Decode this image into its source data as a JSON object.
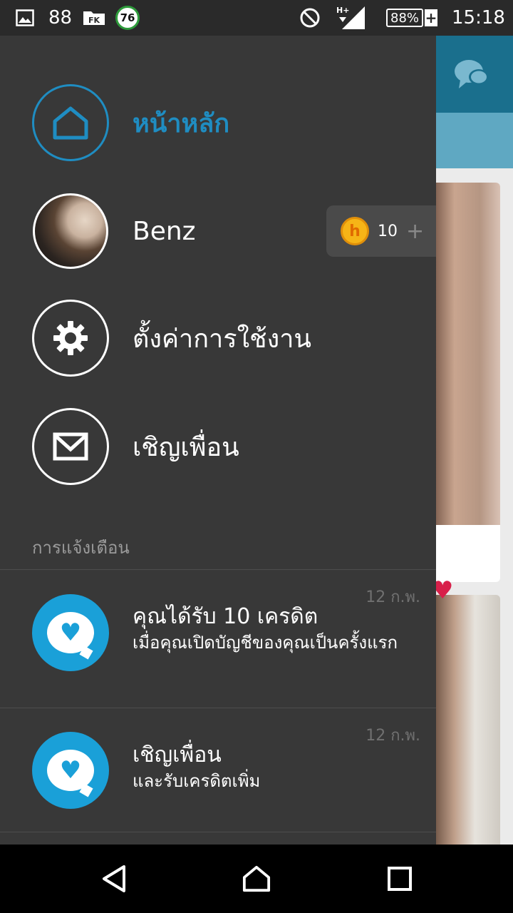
{
  "status_bar": {
    "count_88": "88",
    "badge_76": "76",
    "battery": "88%",
    "time": "15:18"
  },
  "drawer": {
    "menu": [
      {
        "label": "หน้าหลัก"
      },
      {
        "label": "Benz"
      },
      {
        "label": "ตั้งค่าการใช้งาน"
      },
      {
        "label": "เชิญเพื่อน"
      }
    ],
    "credits": {
      "coin_letter": "h",
      "value": "10",
      "add": "+"
    },
    "section_title": "การแจ้งเตือน",
    "notifications": [
      {
        "title": "คุณได้รับ 10 เครดิต",
        "body": "เมื่อคุณเปิดบัญชีของคุณเป็นครั้งแรก",
        "date": "12 ก.พ."
      },
      {
        "title": "เชิญเพื่อน",
        "body": "และรับเครดิตเพิ่ม",
        "date": "12 ก.พ."
      }
    ]
  },
  "colors": {
    "accent": "#1f8dc2",
    "drawer_bg": "#383838",
    "notif_icon": "#1aa0d8",
    "coin": "#f6b417"
  },
  "icons": [
    "image-icon",
    "fk-icon",
    "do-not-disturb-icon",
    "signal-icon",
    "battery-icon",
    "chat-icon",
    "home-icon",
    "gear-icon",
    "mail-icon",
    "heart-chat-icon",
    "back-icon",
    "home-nav-icon",
    "recents-icon"
  ]
}
